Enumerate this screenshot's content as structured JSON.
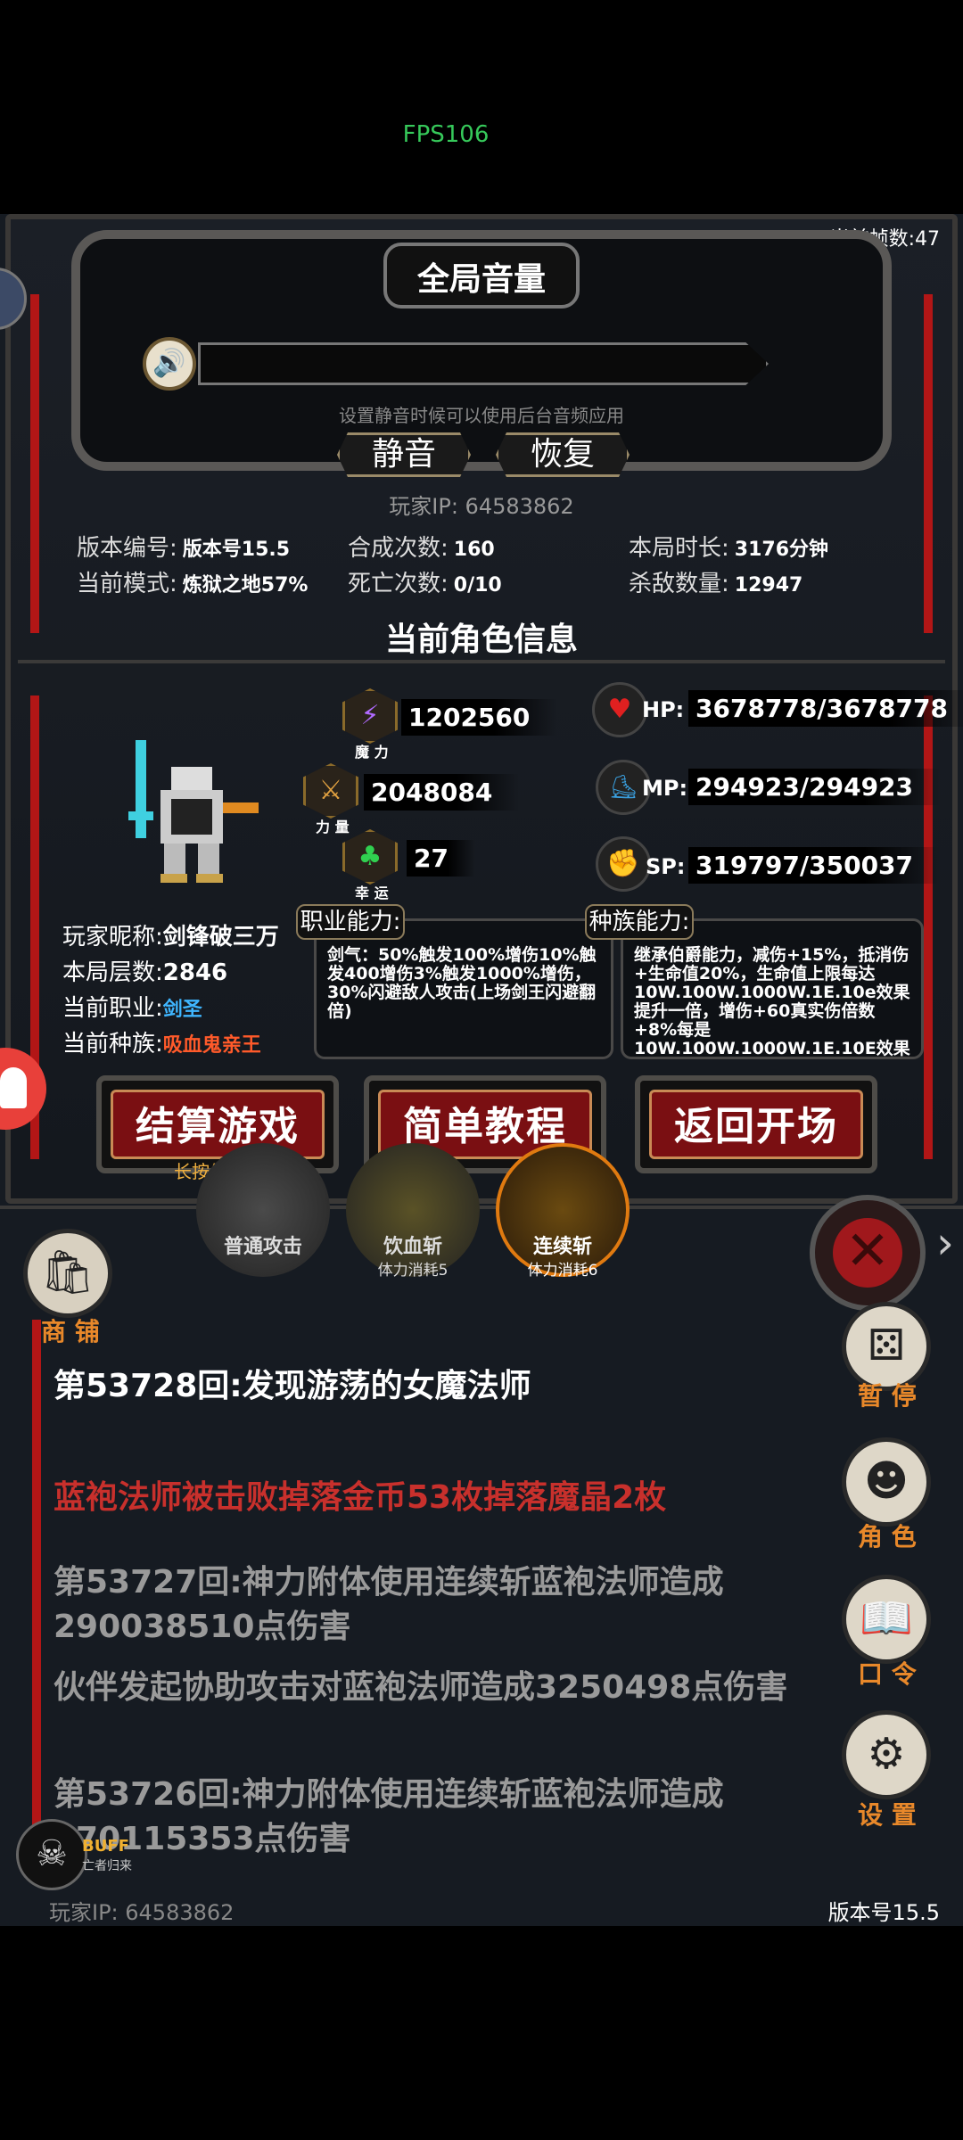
{
  "fps_overlay": "FPS106",
  "current_frame": "当前帧数:47",
  "volume": {
    "title": "全局音量",
    "hint": "设置静音时候可以使用后台音频应用",
    "mute_label": "静音",
    "restore_label": "恢复"
  },
  "player_ip": "玩家IP:  64583862",
  "stats": {
    "version_key": "版本编号:",
    "version_val": "版本号15.5",
    "mode_key": "当前模式:",
    "mode_val": "炼狱之地57%",
    "synth_key": "合成次数:",
    "synth_val": "160",
    "death_key": "死亡次数:",
    "death_val": "0/10",
    "time_key": "本局时长:",
    "time_val": "3176分钟",
    "kill_key": "杀敌数量:",
    "kill_val": "12947"
  },
  "section_title": "当前角色信息",
  "attributes": {
    "magic_val": "1202560",
    "magic_cap": "魔 力",
    "power_val": "2048084",
    "power_cap": "力 量",
    "luck_val": "27",
    "luck_cap": "幸 运"
  },
  "resources": {
    "hp_label": "HP:",
    "hp_val": "3678778/3678778",
    "mp_label": "MP:",
    "mp_val": "294923/294923",
    "sp_label": "SP:",
    "sp_val": "319797/350037"
  },
  "character": {
    "name_key": "玩家昵称:",
    "name_val": "剑锋破三万",
    "floor_key": "本局层数:",
    "floor_val": "2846",
    "class_key": "当前职业:",
    "class_val": "剑圣",
    "race_key": "当前种族:",
    "race_val": "吸血鬼亲王"
  },
  "job_ability": {
    "tag": "职业能力:",
    "text": "剑气：50%触发100%增伤10%触发400增伤3%触发1000%增伤，30%闪避敌人攻击(上场剑王闪避翻倍)"
  },
  "race_ability": {
    "tag": "种族能力:",
    "text": "继承伯爵能力，减伤+15%，抵消伤+生命值20%，生命值上限每达10W.100W.1000W.1E.10e效果提升一倍，增伤+60真实伤倍数+8%每是10W.100W.1000W.1E.10E效果提升一倍"
  },
  "buttons": {
    "settle": "结算游戏",
    "settle_note": "长按生效",
    "tutorial": "简单教程",
    "back": "返回开场"
  },
  "skills": [
    {
      "name": "普通攻击",
      "sub": ""
    },
    {
      "name": "饮血斩",
      "sub": "体力消耗5"
    },
    {
      "name": "连续斩",
      "sub": "体力消耗6"
    }
  ],
  "side": {
    "shop": "商 铺",
    "pause": "暂 停",
    "role": "角 色",
    "command": "口 令",
    "settings": "设 置"
  },
  "log": [
    {
      "text": "第53728回:发现游荡的女魔法师",
      "color": "#ffffff"
    },
    {
      "text": "蓝袍法师被击败掉落金币53枚掉落魔晶2枚",
      "color": "#c8302c"
    },
    {
      "text": "第53727回:神力附体使用连续斩蓝袍法师造成290038510点伤害",
      "color": "#9a9a9a"
    },
    {
      "text": "伙伴发起协助攻击对蓝袍法师造成3250498点伤害",
      "color": "#9a9a9a"
    },
    {
      "text": "第53726回:神力附体使用连续斩蓝袍法师造成170115353点伤害",
      "color": "#9a9a9a"
    }
  ],
  "buff": {
    "label": "BUFF",
    "sub": "亡者归来"
  },
  "bottom_ip": "玩家IP:   64583862",
  "bottom_version": "版本号15.5",
  "colors": {
    "accent_red": "#b21616",
    "class_blue": "#3fb6ff",
    "race_orange": "#ff5a2a",
    "log_gray": "#9a9a9a"
  }
}
